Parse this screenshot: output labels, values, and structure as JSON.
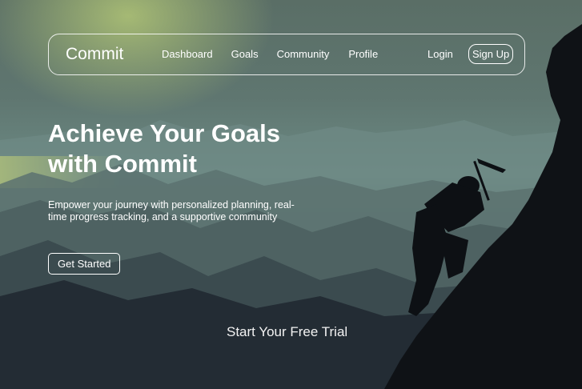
{
  "nav": {
    "brand": "Commit",
    "links": [
      "Dashboard",
      "Goals",
      "Community",
      "Profile"
    ],
    "login": "Login",
    "signup": "Sign Up"
  },
  "hero": {
    "title_line1": "Achieve Your Goals",
    "title_line2": "with Commit",
    "subtitle": "Empower your journey with personalized planning, real-time progress tracking, and a supportive community",
    "cta": "Get Started"
  },
  "footer_cta": "Start Your Free Trial",
  "background": {
    "description_icon": "mountain-climber-silhouette",
    "colors": {
      "sky_glow": "#bed278",
      "mist": "#6c8a84",
      "dark": "#171c24"
    }
  }
}
